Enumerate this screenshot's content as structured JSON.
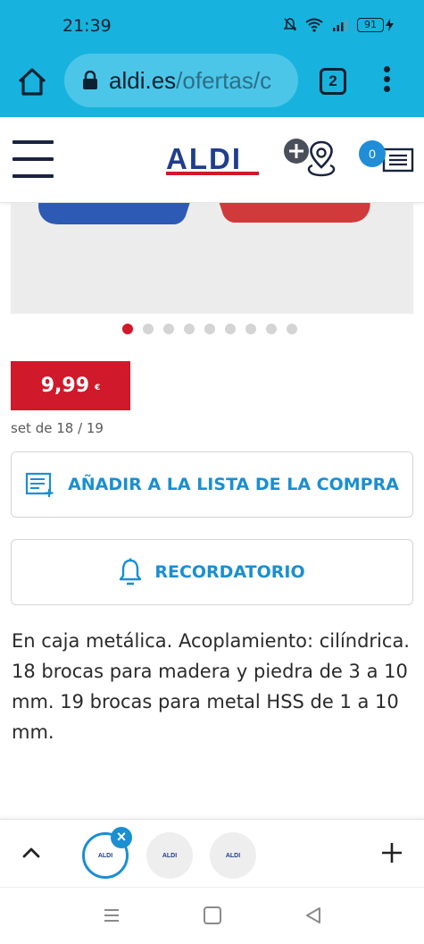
{
  "status_bar": {
    "time": "21:39",
    "battery": "91"
  },
  "browser": {
    "url_domain": "aldi.es",
    "url_path": "/ofertas/c",
    "tab_count": "2"
  },
  "header": {
    "logo": "ALDI",
    "list_count": "0"
  },
  "gallery": {
    "dot_count": 9,
    "active_index": 0
  },
  "product": {
    "price": "9,99",
    "currency": "€",
    "set_info": "set de 18 / 19",
    "add_to_list_label": "AÑADIR A LA LISTA DE LA COMPRA",
    "reminder_label": "RECORDATORIO",
    "description": "En caja metálica. Acoplamiento: cilíndrica. 18 brocas para madera y piedra de 3 a 10 mm. 19 brocas para metal HSS de 1 a 10 mm."
  },
  "tab_switcher": {
    "tabs": [
      {
        "label": "ALDI",
        "active": true
      },
      {
        "label": "ALDI",
        "active": false
      },
      {
        "label": "ALDI",
        "active": false
      }
    ],
    "close_symbol": "×"
  },
  "colors": {
    "browser_bar": "#17b3de",
    "aldi_red": "#d0192a",
    "aldi_blue": "#1f3e8c",
    "accent_blue": "#1a8fd1"
  }
}
